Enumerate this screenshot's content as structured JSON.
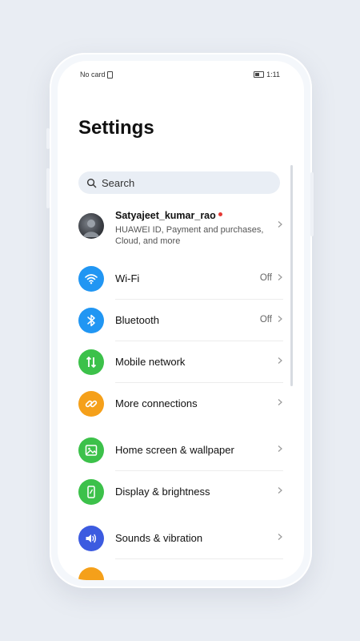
{
  "colors": {
    "wifi": "#2196f3",
    "bluetooth": "#2196f3",
    "mobile": "#3cc14a",
    "connections": "#f5a01a",
    "wallpaper": "#3cc14a",
    "display": "#3cc14a",
    "sounds": "#3c5be0",
    "partial": "#f5a01a"
  },
  "status_bar": {
    "carrier": "No card",
    "time": "1:11"
  },
  "page_title": "Settings",
  "search": {
    "placeholder": "Search"
  },
  "account": {
    "name": "Satyajeet_kumar_rao",
    "subtitle": "HUAWEI ID, Payment and purchases, Cloud, and more"
  },
  "items": [
    {
      "label": "Wi-Fi",
      "value": "Off",
      "icon": "wifi-icon"
    },
    {
      "label": "Bluetooth",
      "value": "Off",
      "icon": "bluetooth-icon"
    },
    {
      "label": "Mobile network",
      "value": "",
      "icon": "mobile-network-icon"
    },
    {
      "label": "More connections",
      "value": "",
      "icon": "link-icon"
    },
    {
      "label": "Home screen & wallpaper",
      "value": "",
      "icon": "wallpaper-icon"
    },
    {
      "label": "Display & brightness",
      "value": "",
      "icon": "display-icon"
    },
    {
      "label": "Sounds & vibration",
      "value": "",
      "icon": "sound-icon"
    }
  ]
}
